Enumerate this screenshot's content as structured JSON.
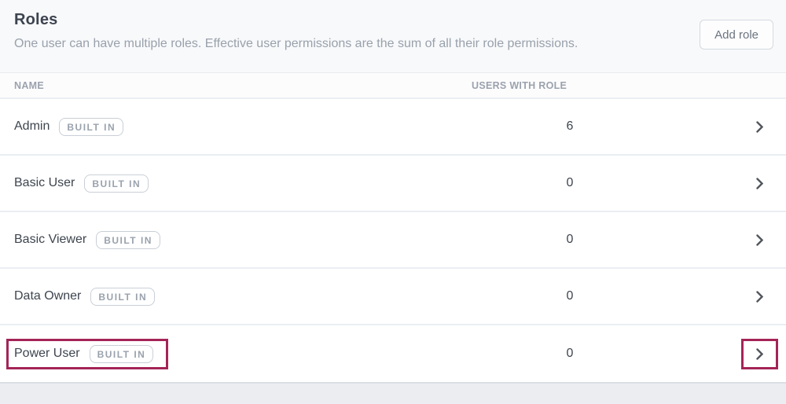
{
  "page": {
    "title": "Roles",
    "subtitle": "One user can have multiple roles. Effective user permissions are the sum of all their role permissions.",
    "add_role_button_label": "Add role"
  },
  "table": {
    "columns": {
      "name": "NAME",
      "users": "USERS WITH ROLE"
    },
    "rows": [
      {
        "name": "Admin",
        "badge": "BUILT IN",
        "users_with_role": "6",
        "highlighted": false
      },
      {
        "name": "Basic User",
        "badge": "BUILT IN",
        "users_with_role": "0",
        "highlighted": false
      },
      {
        "name": "Basic Viewer",
        "badge": "BUILT IN",
        "users_with_role": "0",
        "highlighted": false
      },
      {
        "name": "Data Owner",
        "badge": "BUILT IN",
        "users_with_role": "0",
        "highlighted": false
      },
      {
        "name": "Power User",
        "badge": "BUILT IN",
        "users_with_role": "0",
        "highlighted": true
      }
    ]
  },
  "icons": {
    "row_action": "chevron-right"
  },
  "colors": {
    "annotation_highlight": "#a42457",
    "header_background": "#f8f9fa",
    "footer_background": "#ecedf0",
    "badge_text": "#9aa2ad",
    "row_text": "#3e454f"
  }
}
